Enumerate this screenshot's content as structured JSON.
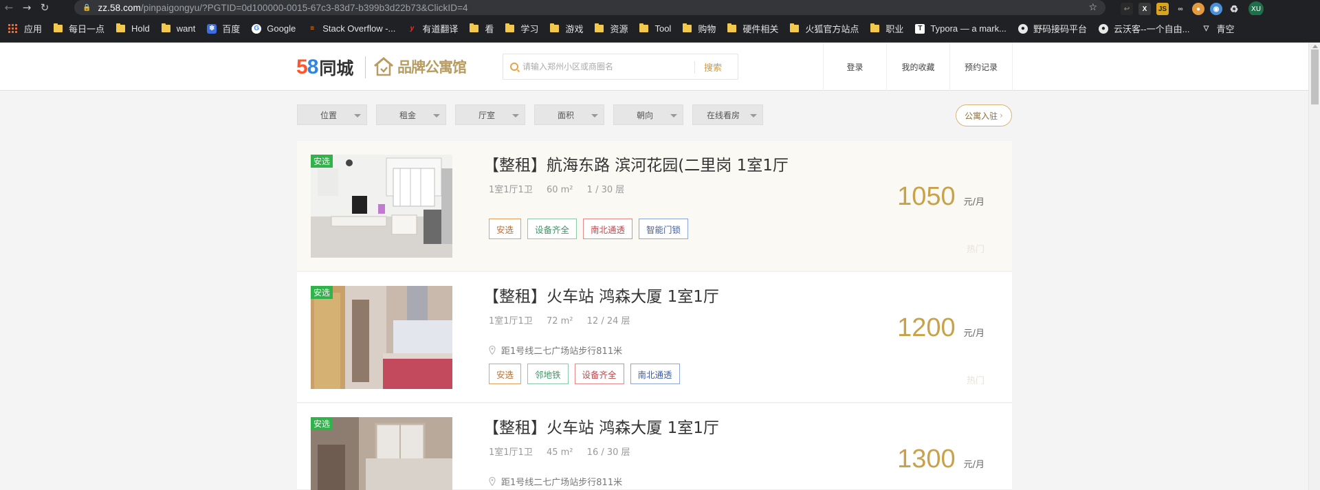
{
  "browser": {
    "url_host": "zz.58.com",
    "url_path": "/pinpaigongyu/?PGTID=0d100000-0015-67c3-83d7-b399b3d22b73&ClickID=4",
    "bookmarks": {
      "apps": "应用",
      "b1": "每日一点",
      "b2": "Hold",
      "b3": "want",
      "b4": "百度",
      "b5": "Google",
      "b6": "Stack Overflow -...",
      "b7": "有道翻译",
      "b8": "看",
      "b9": "学习",
      "b10": "游戏",
      "b11": "资源",
      "b12": "Tool",
      "b13": "购物",
      "b14": "硬件相关",
      "b15": "火狐官方站点",
      "b16": "职业",
      "b17": "Typora — a mark...",
      "b18": "野码接码平台",
      "b19": "云沃客--一个自由...",
      "b20": "青空"
    },
    "avatar": "XU"
  },
  "header": {
    "logo_58": "58",
    "logo_city": "同城",
    "brand_text": "品牌公寓馆",
    "search_placeholder": "请输入郑州小区或商圈名",
    "search_button": "搜索",
    "login": "登录",
    "favorites": "我的收藏",
    "bookings": "预约记录"
  },
  "filters": {
    "location": "位置",
    "rent": "租金",
    "rooms": "厅室",
    "area": "面积",
    "orientation": "朝向",
    "online_viewing": "在线看房",
    "join": "公寓入驻"
  },
  "listings": [
    {
      "badge": "安选",
      "title": "【整租】航海东路 滨河花园(二里岗 1室1厅",
      "layout": "1室1厅1卫",
      "area": "60 m²",
      "floor": "1 / 30 层",
      "location": "",
      "tags": [
        "安选",
        "设备齐全",
        "南北通透",
        "智能门锁"
      ],
      "price": "1050",
      "unit": "元/月",
      "hot": "热门"
    },
    {
      "badge": "安选",
      "title": "【整租】火车站 鸿森大厦 1室1厅",
      "layout": "1室1厅1卫",
      "area": "72 m²",
      "floor": "12 / 24 层",
      "location": "距1号线二七广场站步行811米",
      "tags": [
        "安选",
        "邻地铁",
        "设备齐全",
        "南北通透"
      ],
      "price": "1200",
      "unit": "元/月",
      "hot": "热门"
    },
    {
      "badge": "安选",
      "title": "【整租】火车站 鸿森大厦 1室1厅",
      "layout": "1室1厅1卫",
      "area": "45 m²",
      "floor": "16 / 30 层",
      "location": "距1号线二七广场站步行811米",
      "tags": [],
      "price": "1300",
      "unit": "元/月",
      "hot": ""
    }
  ],
  "colors": {
    "accent_gold": "#c8a24a",
    "badge_green": "#32b24a",
    "tag_orange": "#e8a060",
    "tag_green": "#8cc9a8",
    "tag_red": "#e8888a",
    "tag_blue": "#8ca6d8"
  }
}
